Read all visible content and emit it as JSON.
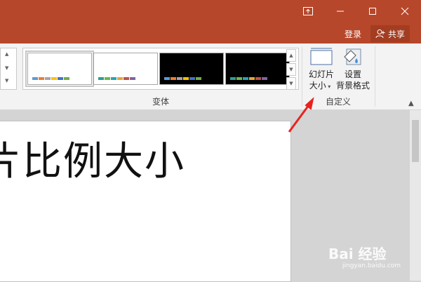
{
  "titlebar": {
    "ribbon_display_icon": "ribbon-display-icon",
    "minimize_icon": "minimize-icon",
    "maximize_icon": "maximize-icon",
    "close_icon": "close-icon",
    "login_label": "登录",
    "share_label": "共享",
    "share_icon": "person-icon",
    "color": "#b7472a"
  },
  "ribbon": {
    "variants_group_label": "变体",
    "customize_group_label": "自定义",
    "slide_size_line1": "幻灯片",
    "slide_size_line2": "大小",
    "format_bg_line1": "设置",
    "format_bg_line2": "背景格式",
    "variants": [
      {
        "bg": "#ffffff",
        "selected": true,
        "bars": [
          "#5b9bd5",
          "#ed7d31",
          "#a5a5a5",
          "#ffc000",
          "#4472c4",
          "#70ad47"
        ]
      },
      {
        "bg": "#ffffff",
        "selected": false,
        "bars": [
          "#2e9e8f",
          "#6bb64e",
          "#29a3b5",
          "#e2a53a",
          "#c0504d",
          "#8064a2"
        ]
      },
      {
        "bg": "#000000",
        "selected": false,
        "bars": [
          "#5b9bd5",
          "#ed7d31",
          "#a5a5a5",
          "#ffc000",
          "#4472c4",
          "#70ad47"
        ]
      },
      {
        "bg": "#000000",
        "selected": false,
        "bars": [
          "#2e9e8f",
          "#6bb64e",
          "#29a3b5",
          "#e2a53a",
          "#c0504d",
          "#8064a2"
        ]
      }
    ]
  },
  "slide": {
    "title_text": "片比例大小"
  },
  "watermark": {
    "text": "Bai 经验",
    "sub": "jingyan.baidu.com"
  },
  "annotation": {
    "arrow_color": "#e8231f"
  }
}
